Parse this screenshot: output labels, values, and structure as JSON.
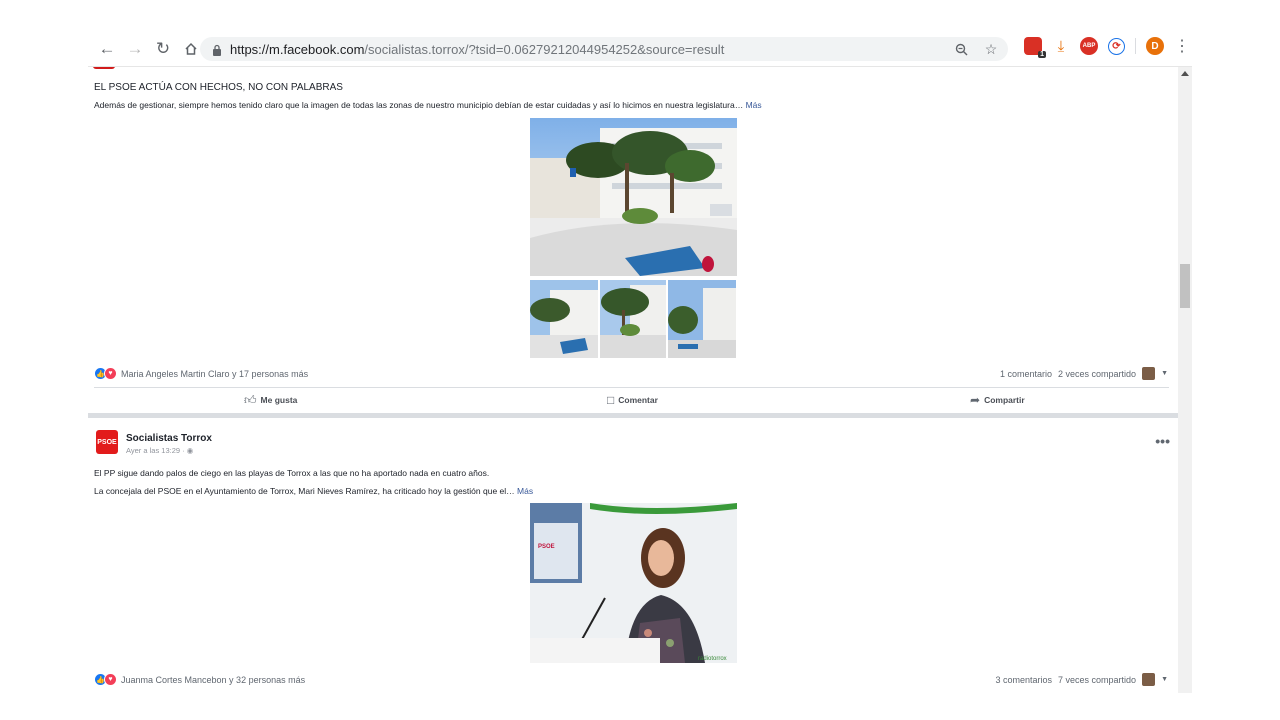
{
  "browser": {
    "url_host": "https://m.facebook.com",
    "url_rest": "/socialistas.torrox/?tsid=0.06279212044954252&source=result",
    "ext_counter_badge": "1",
    "profile_initial": "D",
    "ext_abp_label": "ABP"
  },
  "post1": {
    "title": "EL PSOE ACTÚA CON HECHOS, NO CON PALABRAS",
    "body": "Además de gestionar, siempre hemos tenido claro que la imagen de todas las zonas de nuestro municipio debían de estar cuidadas y así lo hicimos en nuestra legislatura…",
    "more": "Más",
    "reactions_text": "Maria Angeles Martin Claro y 17 personas más",
    "comments": "1 comentario",
    "shares": "2 veces compartido",
    "like_label": "Me gusta",
    "comment_label": "Comentar",
    "share_label": "Compartir"
  },
  "post2": {
    "page_name": "Socialistas Torrox",
    "logo_text": "PSOE",
    "time": "Ayer a las 13:29 · ",
    "line1": "El PP sigue dando palos de ciego en las playas de Torrox a las que no ha aportado nada en cuatro años.",
    "line2": "La concejala del PSOE en el Ayuntamiento de Torrox, Mari Nieves Ramírez, ha criticado hoy la gestión que el…",
    "more": "Más",
    "menu": "•••",
    "photo_sign": "PSOE",
    "photo_watermark": "radiotorrox",
    "reactions_text": "Juanma Cortes Mancebon y 32 personas más",
    "comments": "3 comentarios",
    "shares": "7 veces compartido"
  }
}
